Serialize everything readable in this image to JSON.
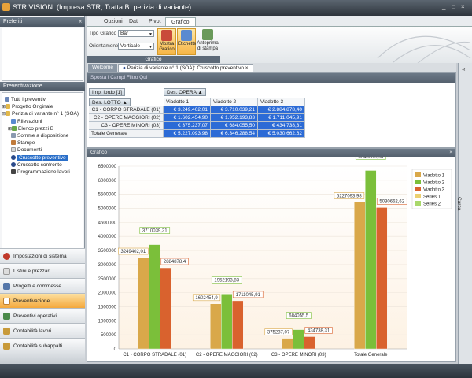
{
  "window": {
    "title": "STR VISION: (Impresa STR, Tratta B :perizia di variante)",
    "controls": [
      "_",
      "□",
      "×"
    ]
  },
  "ribbon": {
    "tabs": [
      {
        "label": "Opzioni"
      },
      {
        "label": "Dati"
      },
      {
        "label": "Pivot"
      },
      {
        "label": "Grafico"
      }
    ],
    "tipo_grafico_label": "Tipo Grafico",
    "tipo_grafico_value": "Bar",
    "orientamento_label": "Orientamento",
    "orientamento_value": "Verticale",
    "buttons": [
      {
        "label": "Mostra Grafico"
      },
      {
        "label": "Etichette"
      },
      {
        "label": "Anteprima di stampa"
      }
    ],
    "group_label": "Grafico"
  },
  "leftpane": {
    "preferiti": "Preferiti",
    "preventivazione": "Preventivazione",
    "tree": [
      {
        "label": "Tutti i preventivi"
      },
      {
        "label": "Progetto Originale"
      },
      {
        "label": "Perizia di variante n° 1 (SOA)"
      },
      {
        "label": "Rilevazioni"
      },
      {
        "label": "Elenco prezzi B"
      },
      {
        "label": "Somme a disposizione"
      },
      {
        "label": "Stampe"
      },
      {
        "label": "Documenti"
      },
      {
        "label": "Cruscotto preventivo"
      },
      {
        "label": "Cruscotto confronto"
      },
      {
        "label": "Programmazione lavori"
      }
    ],
    "nav": [
      {
        "label": "Impostazioni di sistema"
      },
      {
        "label": "Listini e prezzari"
      },
      {
        "label": "Progetti e commesse"
      },
      {
        "label": "Preventivazione"
      },
      {
        "label": "Preventivi operativi"
      },
      {
        "label": "Contabilità lavori"
      },
      {
        "label": "Contabilità subappalti"
      }
    ]
  },
  "doctabs": [
    {
      "label": "Welcome"
    },
    {
      "label": "Perizia di variante n° 1 (SOA): Cruscotto preventivo"
    }
  ],
  "pivot": {
    "filter_text": "Sposta i Campi Filtro Qui",
    "data_field": "Imp. lordo [1]",
    "column_field": "Des. OPERA",
    "row_field": "Des. LOTTO",
    "columns": [
      "Viadotto 1",
      "Viadotto 2",
      "Viadotto 3"
    ],
    "rows": [
      {
        "label": "C1 - CORPO STRADALE (01)",
        "values": [
          "€ 3.249.402,01",
          "€ 3.710.039,21",
          "€ 2.884.878,40"
        ]
      },
      {
        "label": "C2 - OPERE MAGGIORI (02)",
        "values": [
          "€ 1.602.454,90",
          "€ 1.952.193,83",
          "€ 1.711.045,91"
        ]
      },
      {
        "label": "C3 - OPERE MINORI (03)",
        "values": [
          "€ 375.237,07",
          "€ 684.055,50",
          "€ 434.738,31"
        ]
      },
      {
        "label": "Totale Generale",
        "values": [
          "€ 5.227.093,98",
          "€ 6.346.288,54",
          "€ 5.030.662,62"
        ]
      }
    ]
  },
  "chart_panel_title": "Grafico",
  "right_strip_label": "Carca",
  "colors": {
    "v1": "#d9a84a",
    "v2": "#7bbf3a",
    "v3": "#d9622e",
    "s1": "#ecd070",
    "s2": "#a9d86b"
  },
  "chart_data": {
    "type": "bar",
    "categories": [
      "C1 - CORPO STRADALE (01)",
      "C2 - OPERE MAGGIORI (02)",
      "C3 - OPERE MINORI (03)",
      "Totale Generale"
    ],
    "series": [
      {
        "name": "Viadotto 1",
        "values": [
          3249402.01,
          1602454.9,
          375237.07,
          5227093.98
        ],
        "labels": [
          "3249402,01",
          "1602454,9",
          "375237,07",
          "5227093,98"
        ]
      },
      {
        "name": "Viadotto 2",
        "values": [
          3710039.21,
          1952193.83,
          684055.5,
          6346288.54
        ],
        "labels": [
          "3710039,21",
          "1952193,83",
          "684055,5",
          "6346288,54"
        ]
      },
      {
        "name": "Viadotto 3",
        "values": [
          2884878.4,
          1711045.91,
          434738.31,
          5030662.62
        ],
        "labels": [
          "2884878,4",
          "1711045,91",
          "434738,31",
          "5030662,62"
        ]
      }
    ],
    "legend": [
      "Viadotto 1",
      "Viadotto 2",
      "Viadotto 3",
      "Series 1",
      "Series 2"
    ],
    "ylim": [
      0,
      6500000
    ],
    "yticks": [
      0,
      500000,
      1000000,
      1500000,
      2000000,
      2500000,
      3000000,
      3500000,
      4000000,
      4500000,
      5000000,
      5500000,
      6000000,
      6500000
    ],
    "grid": true,
    "legend_position": "top-right"
  }
}
